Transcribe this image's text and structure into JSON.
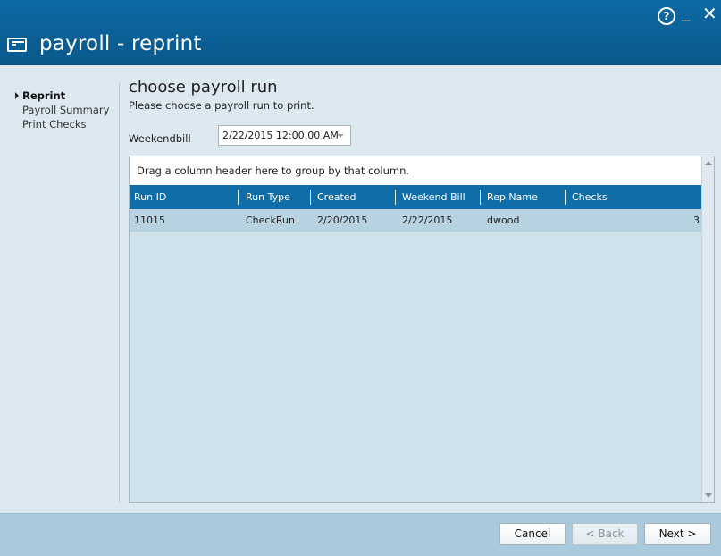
{
  "window": {
    "title": "payroll - reprint",
    "controls": {
      "help": "?",
      "minimize": "_",
      "close": "✕"
    }
  },
  "sidebar": {
    "items": [
      {
        "label": "Reprint",
        "active": true
      },
      {
        "label": "Payroll Summary",
        "active": false
      },
      {
        "label": "Print Checks",
        "active": false
      }
    ]
  },
  "main": {
    "heading": "choose payroll run",
    "subheading": "Please choose a payroll run to print.",
    "weekendbill": {
      "label": "Weekendbill",
      "value": "2/22/2015 12:00:00 AM"
    },
    "grid": {
      "group_panel_text": "Drag a column header here to group by that column.",
      "columns": [
        "Run ID",
        "Run Type",
        "Created",
        "Weekend Bill",
        "Rep Name",
        "Checks"
      ],
      "rows": [
        [
          "11015",
          "CheckRun",
          "2/20/2015",
          "2/22/2015",
          "dwood",
          "3"
        ]
      ]
    }
  },
  "footer": {
    "cancel_label": "Cancel",
    "back_label": "< Back",
    "next_label": "Next >"
  },
  "colors": {
    "titlebar": "#0e6aa4",
    "grid_header": "#0f6ea8",
    "selected_row": "#b7d2e1",
    "footer": "#a9cadd"
  }
}
